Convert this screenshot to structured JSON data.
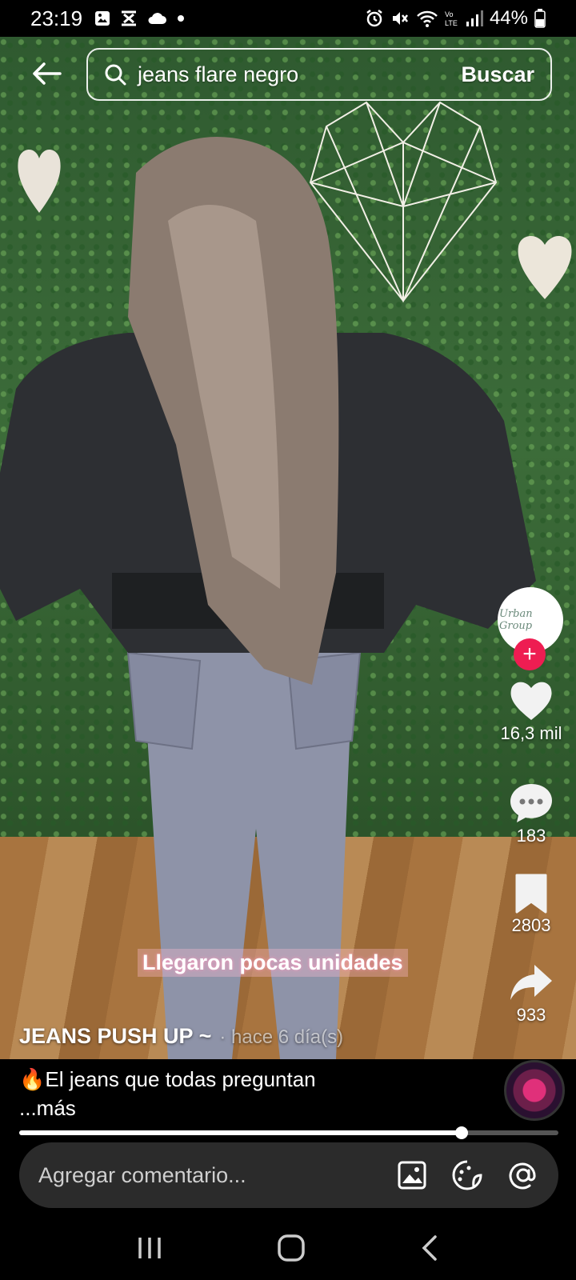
{
  "status_bar": {
    "time": "23:19",
    "battery_percent": "44%",
    "icons": [
      "gallery-icon",
      "cast-icon",
      "cloud-icon",
      "dot-icon",
      "alarm-icon",
      "mute-icon",
      "wifi-icon",
      "volte-icon",
      "signal-icon",
      "battery-icon"
    ]
  },
  "search": {
    "query": "jeans flare negro",
    "button_label": "Buscar"
  },
  "video": {
    "overlay_caption": "Llegaron pocas unidades",
    "author": "JEANS PUSH UP ~",
    "posted": "· hace 6 día(s)",
    "avatar_text": "Urban Group"
  },
  "actions": {
    "likes": "16,3 mil",
    "comments": "183",
    "saves": "2803",
    "shares": "933"
  },
  "description": {
    "text": "🔥El jeans que todas preguntan",
    "more": "...más"
  },
  "progress": {
    "fraction": 0.82
  },
  "comment_bar": {
    "placeholder": "Agregar comentario..."
  },
  "colors": {
    "follow_red": "#ee1d52",
    "comment_bg": "#2b2b2b"
  }
}
